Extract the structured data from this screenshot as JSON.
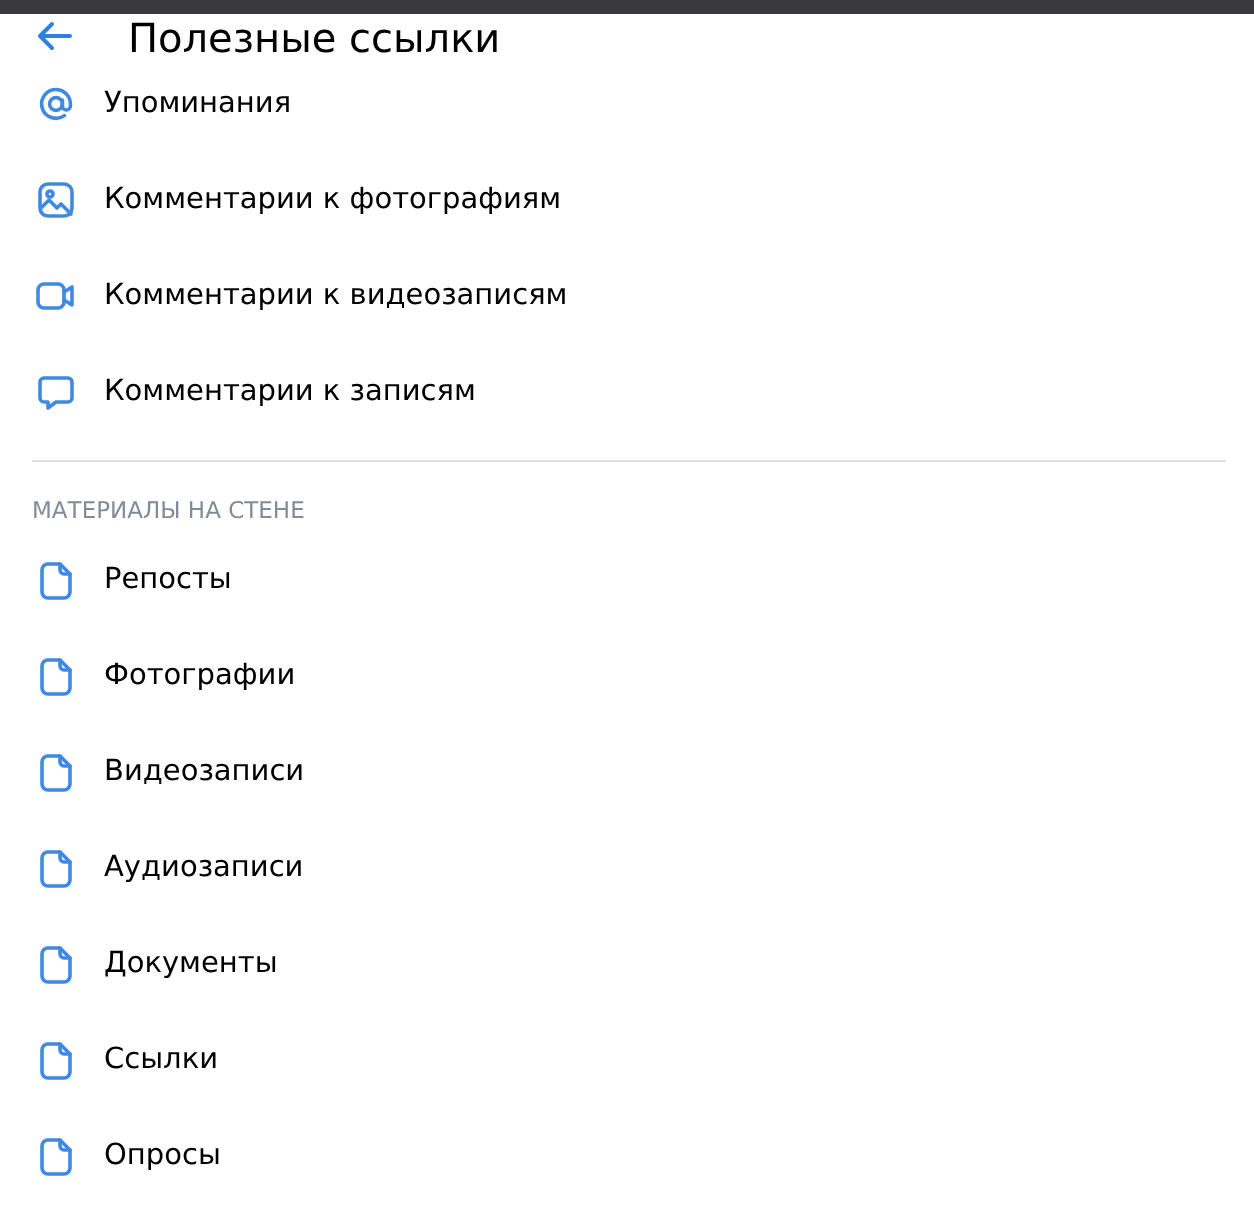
{
  "header": {
    "title": "Полезные ссылки"
  },
  "sections": [
    {
      "items": [
        {
          "kind": "mention",
          "label": "Упоминания"
        },
        {
          "kind": "photo",
          "label": "Комментарии к фотографиям"
        },
        {
          "kind": "video",
          "label": "Комментарии к видеозаписям"
        },
        {
          "kind": "comment",
          "label": "Комментарии к записям"
        }
      ]
    },
    {
      "title": "МАТЕРИАЛЫ НА СТЕНЕ",
      "items": [
        {
          "kind": "document",
          "label": "Репосты"
        },
        {
          "kind": "document",
          "label": "Фотографии"
        },
        {
          "kind": "document",
          "label": "Видеозаписи"
        },
        {
          "kind": "document",
          "label": "Аудиозаписи"
        },
        {
          "kind": "document",
          "label": "Документы"
        },
        {
          "kind": "document",
          "label": "Ссылки"
        },
        {
          "kind": "document",
          "label": "Опросы"
        }
      ]
    }
  ]
}
